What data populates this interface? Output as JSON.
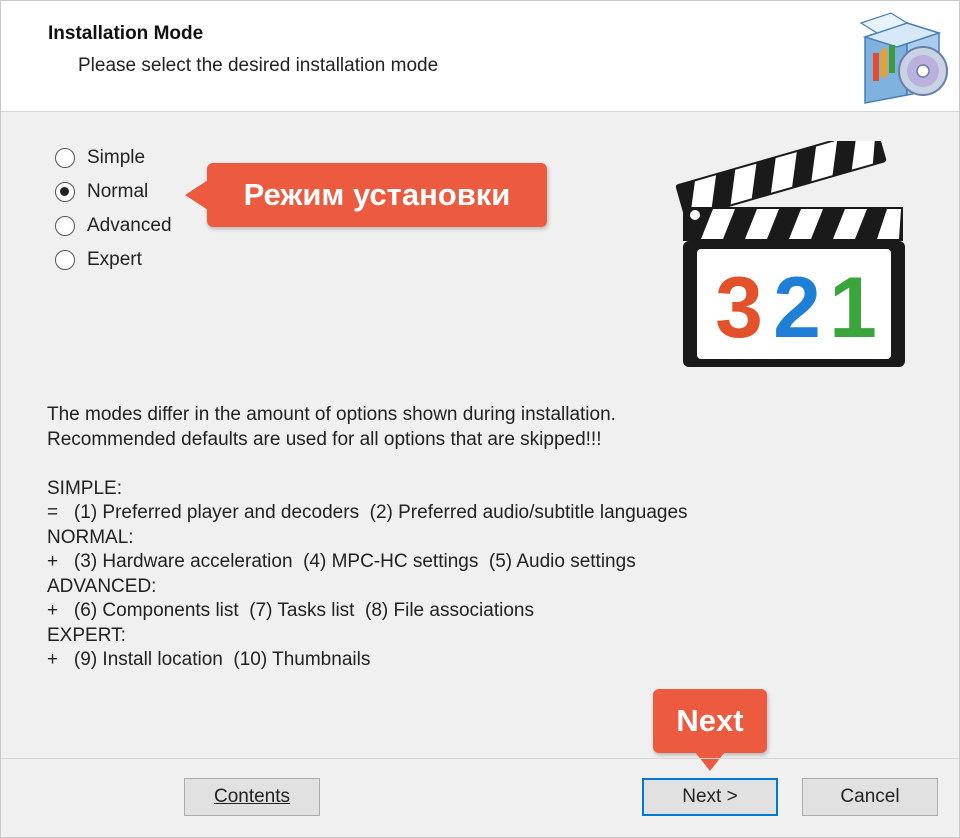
{
  "header": {
    "title": "Installation Mode",
    "subtitle": "Please select the desired installation mode"
  },
  "modes": [
    {
      "label": "Simple",
      "checked": false
    },
    {
      "label": "Normal",
      "checked": true
    },
    {
      "label": "Advanced",
      "checked": false
    },
    {
      "label": "Expert",
      "checked": false
    }
  ],
  "callouts": {
    "mode": "Режим установки",
    "next": "Next"
  },
  "logo": {
    "digits": [
      "3",
      "2",
      "1"
    ],
    "digit_colors": [
      "#e2512a",
      "#1f7fd6",
      "#3aa53a"
    ]
  },
  "description": [
    "The modes differ in the amount of options shown during installation.",
    "Recommended defaults are used for all options that are skipped!!!",
    "",
    "SIMPLE:",
    "=   (1) Preferred player and decoders  (2) Preferred audio/subtitle languages",
    "NORMAL:",
    "+   (3) Hardware acceleration  (4) MPC-HC settings  (5) Audio settings",
    "ADVANCED:",
    "+   (6) Components list  (7) Tasks list  (8) File associations",
    "EXPERT:",
    "+   (9) Install location  (10) Thumbnails"
  ],
  "buttons": {
    "contents": "Contents",
    "next": "Next >",
    "cancel": "Cancel"
  },
  "colors": {
    "callout": "#ec5b3f",
    "focus_border": "#0078d7"
  }
}
